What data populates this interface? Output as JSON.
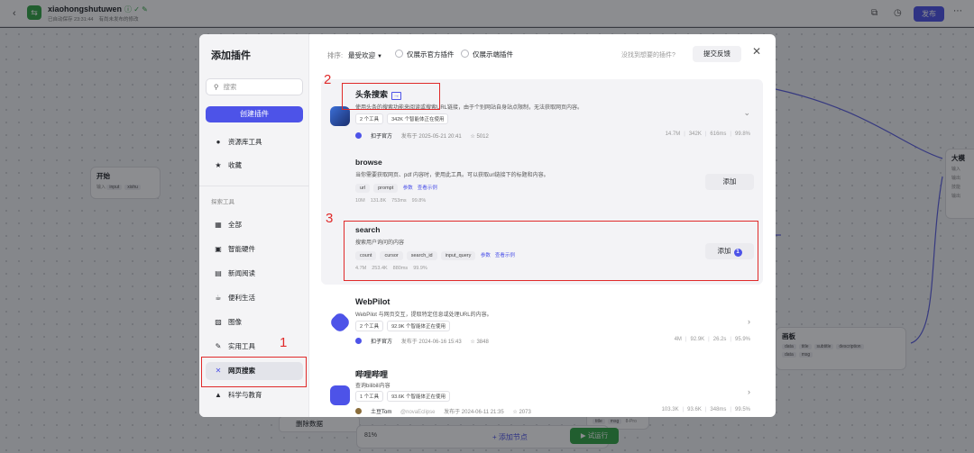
{
  "app": {
    "title": "xiaohongshutuwen",
    "autosave": "已自动保存 23:31:44",
    "unpublished": "有尚未发布的修改",
    "publish_label": "发布"
  },
  "canvas": {
    "start_node": {
      "title": "开始",
      "label": "输入",
      "tags": [
        "input",
        "xishu"
      ]
    },
    "big_node_title": "大模",
    "big_node_rows": [
      "输入",
      "输出",
      "技能",
      "输出"
    ],
    "canvas_node": {
      "title": "画板",
      "tags_row1": [
        "data",
        "title",
        "subtitle",
        "description"
      ],
      "tags_row2": [
        "data",
        "msg"
      ]
    },
    "bottom_node_tags": [
      "title",
      "msg"
    ],
    "model_name": "8-Pro",
    "zoom_level": "81%",
    "add_node_label": "添加节点",
    "run_label": "试运行",
    "delete_data_label": "删除数据"
  },
  "modal": {
    "title": "添加插件",
    "search_placeholder": "搜索",
    "create_plugin_label": "创建插件",
    "top_items": [
      {
        "label": "资源库工具",
        "icon": "person-icon"
      },
      {
        "label": "收藏",
        "icon": "star-icon"
      }
    ],
    "section_title": "探索工具",
    "categories": [
      {
        "label": "全部",
        "icon": "grid-icon"
      },
      {
        "label": "智能硬件",
        "icon": "chip-icon"
      },
      {
        "label": "新闻阅读",
        "icon": "book-icon"
      },
      {
        "label": "便利生活",
        "icon": "cup-icon"
      },
      {
        "label": "图像",
        "icon": "image-icon"
      },
      {
        "label": "实用工具",
        "icon": "wrench-icon"
      },
      {
        "label": "网页搜索",
        "icon": "web-search-icon",
        "active": true
      },
      {
        "label": "科学与教育",
        "icon": "graduation-cap-icon"
      }
    ],
    "filter": {
      "sort_label": "排序:",
      "sort_value": "最受欢迎",
      "official_only": "仅展示官方插件",
      "client_only": "仅展示端插件",
      "cant_find": "没找到想要的插件?",
      "feedback_label": "提交反馈"
    },
    "plugins": [
      {
        "name": "头条搜索",
        "description": "使用头条的搜索功能来阅读或搜索URL链接，由于个别网站自身站点限制，无法获取网页内容。",
        "tags": [
          "2 个工具",
          "342K 个智能体正在使用"
        ],
        "author": "扣子官方",
        "published": "发布于 2025-05-21 20:41",
        "favorites": "5012",
        "stats": [
          "14.7M",
          "342K",
          "616ms",
          "99.8%"
        ],
        "tools": [
          {
            "name": "browse",
            "description": "当你需要获取网页、pdf 内容时，使用此工具。可以获取url链接下的标题和内容。",
            "params": [
              "url",
              "prompt"
            ],
            "params_link": "参数",
            "example_link": "查看示例",
            "stats": [
              "10M",
              "131.8K",
              "753ms",
              "99.8%"
            ],
            "add_label": "添加"
          },
          {
            "name": "search",
            "description": "搜索用户询问的内容",
            "params": [
              "count",
              "cursor",
              "search_id",
              "input_query"
            ],
            "params_link": "参数",
            "example_link": "查看示例",
            "stats": [
              "4.7M",
              "253.4K",
              "880ms",
              "99.9%"
            ],
            "add_label": "添加",
            "added_count": "1"
          }
        ]
      },
      {
        "name": "WebPilot",
        "description": "WebPilot 与网页交互，提取特定信息或处理URL的内容。",
        "tags": [
          "2 个工具",
          "92.9K 个智能体正在使用"
        ],
        "author": "扣子官方",
        "published": "发布于 2024-06-16 15:43",
        "favorites": "3848",
        "stats": [
          "4M",
          "92.9K",
          "26.2s",
          "95.9%"
        ]
      },
      {
        "name": "哔哩哔哩",
        "description": "查询bilibili内容",
        "tags": [
          "1 个工具",
          "93.6K 个智能体正在使用"
        ],
        "author": "土豆Tom",
        "author_handle": "@novaEclipse",
        "published": "发布于 2024-06-11 21:35",
        "favorites": "2073",
        "stats": [
          "103.3K",
          "93.6K",
          "348ms",
          "99.5%"
        ]
      }
    ]
  },
  "annotations": [
    "1",
    "2",
    "3"
  ],
  "colors": {
    "accent": "#4d53e8",
    "annotation": "#e02a2a",
    "run": "#32a645"
  }
}
